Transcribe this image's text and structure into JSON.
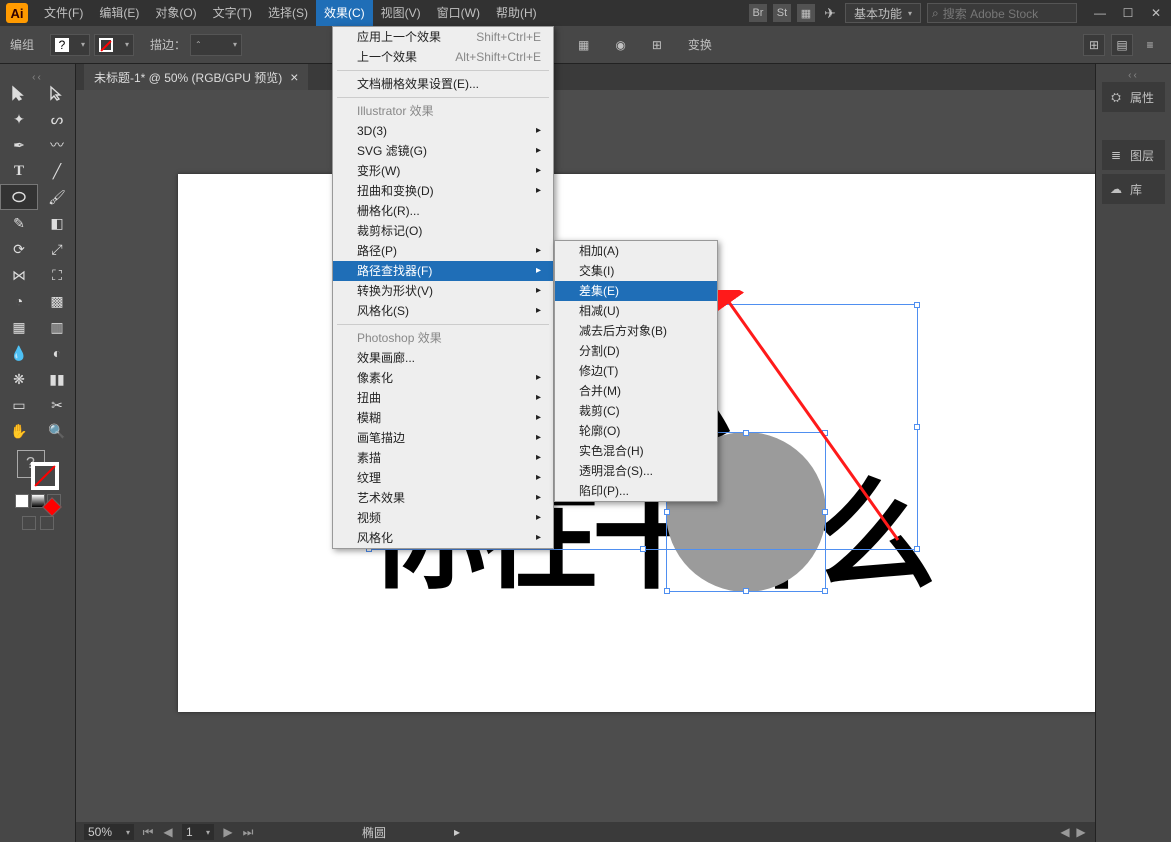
{
  "app": {
    "logo": "Ai"
  },
  "menubar": [
    "文件(F)",
    "编辑(E)",
    "对象(O)",
    "文字(T)",
    "选择(S)",
    "效果(C)",
    "视图(V)",
    "窗口(W)",
    "帮助(H)"
  ],
  "menubar_open_index": 5,
  "titlebar": {
    "workspace_label": "基本功能",
    "search_placeholder": "搜索 Adobe Stock"
  },
  "controlbar": {
    "context_label": "编组",
    "stroke_label": "描边：",
    "transform_label": "变换"
  },
  "doc_tab": {
    "title": "未标题-1* @ 50% (RGB/GPU 预览)"
  },
  "canvas": {
    "row1": "干什么",
    "row2": "你在干什么"
  },
  "menu1": {
    "top": [
      {
        "label": "应用上一个效果",
        "shortcut": "Shift+Ctrl+E"
      },
      {
        "label": "上一个效果",
        "shortcut": "Alt+Shift+Ctrl+E"
      }
    ],
    "doc_settings": "文档栅格效果设置(E)...",
    "ill_header": "Illustrator 效果",
    "ill_items": [
      "3D(3)",
      "SVG 滤镜(G)",
      "变形(W)",
      "扭曲和变换(D)",
      "栅格化(R)...",
      "裁剪标记(O)",
      "路径(P)",
      "路径查找器(F)",
      "转换为形状(V)",
      "风格化(S)"
    ],
    "ill_highlight_index": 7,
    "ps_header": "Photoshop 效果",
    "ps_items": [
      "效果画廊...",
      "像素化",
      "扭曲",
      "模糊",
      "画笔描边",
      "素描",
      "纹理",
      "艺术效果",
      "视频",
      "风格化"
    ]
  },
  "menu2": {
    "items": [
      "相加(A)",
      "交集(I)",
      "差集(E)",
      "相减(U)",
      "减去后方对象(B)",
      "分割(D)",
      "修边(T)",
      "合并(M)",
      "裁剪(C)",
      "轮廓(O)",
      "实色混合(H)",
      "透明混合(S)...",
      "陷印(P)..."
    ],
    "highlight_index": 2
  },
  "right_panels": [
    "属性",
    "图层",
    "库"
  ],
  "statusbar": {
    "zoom": "50%",
    "page": "1",
    "tool_label": "椭圆"
  }
}
